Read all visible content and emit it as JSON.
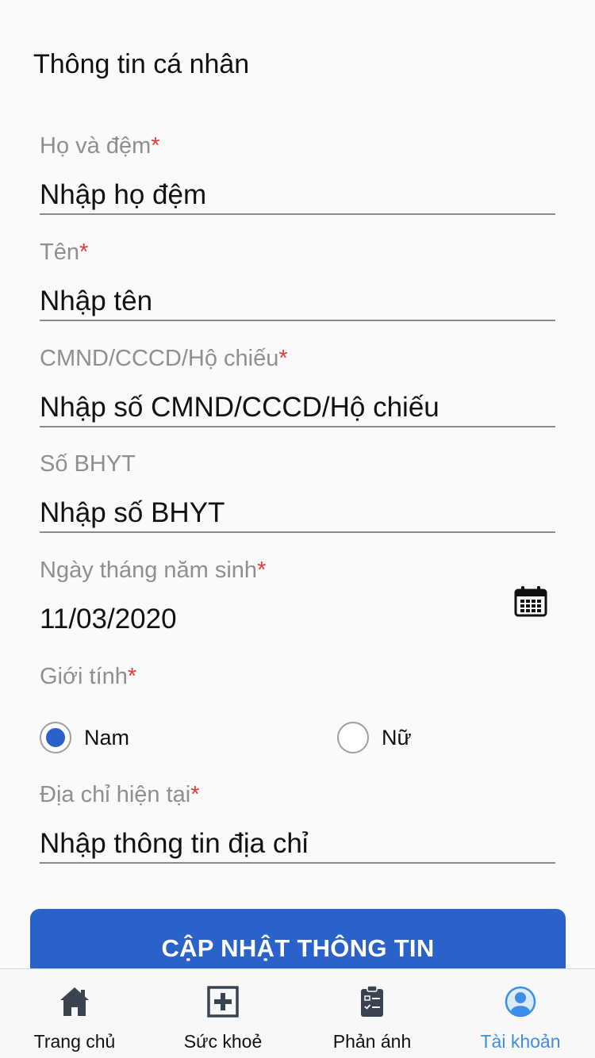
{
  "page": {
    "title": "Thông tin cá nhân"
  },
  "fields": {
    "last_name": {
      "label": "Họ và đệm",
      "required": "*",
      "placeholder": "Nhập họ đệm"
    },
    "first_name": {
      "label": "Tên",
      "required": "*",
      "placeholder": "Nhập tên"
    },
    "id_number": {
      "label": "CMND/CCCD/Hộ chiếu",
      "required": "*",
      "placeholder": "Nhập số CMND/CCCD/Hộ chiếu"
    },
    "insurance": {
      "label": "Số BHYT",
      "placeholder": "Nhập số BHYT"
    },
    "dob": {
      "label": "Ngày tháng năm sinh",
      "required": "*",
      "value": "11/03/2020",
      "icon": "calendar-icon"
    },
    "gender": {
      "label": "Giới tính",
      "required": "*",
      "options": [
        "Nam",
        "Nữ"
      ],
      "selected": "Nam"
    },
    "address": {
      "label": "Địa chỉ hiện tại",
      "required": "*",
      "placeholder": "Nhập thông tin địa chỉ"
    }
  },
  "submit": {
    "label": "CẬP NHẬT THÔNG TIN"
  },
  "tabs": [
    {
      "label": "Trang chủ",
      "icon": "home-icon",
      "active": false
    },
    {
      "label": "Sức khoẻ",
      "icon": "health-plus-icon",
      "active": false
    },
    {
      "label": "Phản ánh",
      "icon": "clipboard-icon",
      "active": false
    },
    {
      "label": "Tài khoản",
      "icon": "account-icon",
      "active": true
    }
  ],
  "colors": {
    "accent": "#2b62c9",
    "active_tab": "#3d8ee8",
    "required": "#e53935",
    "label": "#8e8e93"
  }
}
